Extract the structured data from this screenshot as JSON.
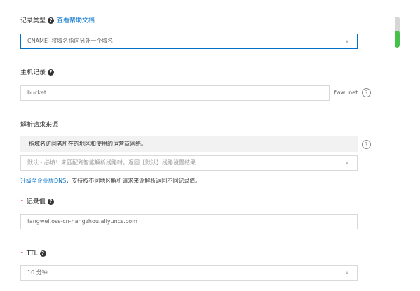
{
  "record_type": {
    "label": "记录类型",
    "help_link": "查看帮助文档",
    "value": "CNAME- 将域名指向另外一个域名"
  },
  "host": {
    "label": "主机记录",
    "value": "bucket",
    "suffix": ".fwwl.net"
  },
  "resolution_source": {
    "label": "解析请求来源",
    "info": "指域名访问者所在的地区和使用的运营商网络。",
    "placeholder": "默认 - 必填！未匹配到智能解析线路时，返回【默认】线路设置结果",
    "upgrade_link": "升级至企业版DNS",
    "upgrade_note": "，支持按不同地区解析请求来源解析返回不同记录值。"
  },
  "record_value": {
    "label": "记录值",
    "value": "fangwei.oss-cn-hangzhou.aliyuncs.com"
  },
  "ttl": {
    "label": "TTL",
    "value": "10 分钟"
  },
  "icons": {
    "help": "?",
    "chevron": "∨",
    "required": "•"
  },
  "colors": {
    "accent": "#0070cc",
    "required": "#e23b3b",
    "scroll": "#45c04a"
  },
  "scroll_progress": 0.55
}
